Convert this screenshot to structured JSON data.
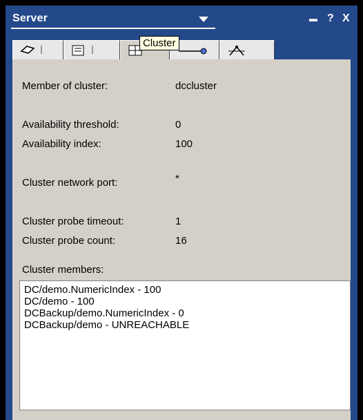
{
  "header": {
    "title": "Server"
  },
  "window_buttons": {
    "minimize": "▬",
    "help": "?",
    "close": "X"
  },
  "tabs": [
    {
      "icon": "eraser-icon"
    },
    {
      "icon": "tree-icon"
    },
    {
      "icon": "cluster-icon"
    },
    {
      "icon": "connector-icon"
    },
    {
      "icon": "network-icon"
    }
  ],
  "tooltip": "Cluster",
  "fields": {
    "member_of_cluster_label": "Member of cluster:",
    "member_of_cluster_value": "dccluster",
    "availability_threshold_label": "Availability threshold:",
    "availability_threshold_value": "0",
    "availability_index_label": "Availability index:",
    "availability_index_value": "100",
    "cluster_network_port_label": "Cluster network port:",
    "cluster_network_port_value": "*",
    "cluster_probe_timeout_label": "Cluster probe timeout:",
    "cluster_probe_timeout_value": "1",
    "cluster_probe_count_label": "Cluster probe count:",
    "cluster_probe_count_value": "16",
    "cluster_members_label": "Cluster members:"
  },
  "cluster_members": [
    "DC/demo.NumericIndex - 100",
    "DC/demo - 100",
    "DCBackup/demo.NumericIndex - 0",
    "DCBackup/demo - UNREACHABLE"
  ],
  "colors": {
    "frame": "#24498a",
    "content": "#d4d0c8",
    "tooltip": "#ffffe1"
  }
}
